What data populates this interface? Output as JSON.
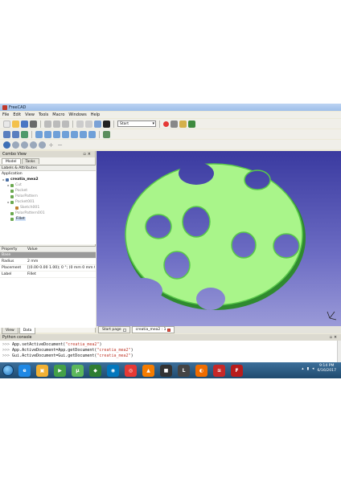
{
  "window": {
    "title": "FreeCAD"
  },
  "menu": [
    "File",
    "Edit",
    "View",
    "Tools",
    "Macro",
    "Windows",
    "Help"
  ],
  "toolbar": {
    "workbench_combo": "Start"
  },
  "combo_view": {
    "title": "Combo View",
    "tabs": [
      "Model",
      "Tasks"
    ],
    "labels_header": "Labels & Attributes",
    "application_label": "Application",
    "tree": [
      {
        "label": "creatia_mea2",
        "level": 0,
        "bold": true,
        "dim": false,
        "color": "#4a6fa5"
      },
      {
        "label": "Cut",
        "level": 1,
        "bold": false,
        "dim": true,
        "color": "#6aa84f"
      },
      {
        "label": "Pocket",
        "level": 1,
        "bold": false,
        "dim": true,
        "color": "#6aa84f"
      },
      {
        "label": "PolarPattern",
        "level": 1,
        "bold": false,
        "dim": true,
        "color": "#6aa84f"
      },
      {
        "label": "Pocket001",
        "level": 1,
        "bold": false,
        "dim": true,
        "color": "#6aa84f"
      },
      {
        "label": "Sketch001",
        "level": 2,
        "bold": false,
        "dim": true,
        "color": "#c08030"
      },
      {
        "label": "PolarPattern001",
        "level": 1,
        "bold": false,
        "dim": true,
        "color": "#6aa84f"
      },
      {
        "label": "Fillet",
        "level": 1,
        "bold": false,
        "dim": false,
        "selected": true,
        "color": "#6aa84f"
      }
    ],
    "property_headers": [
      "Property",
      "Value"
    ],
    "properties": [
      {
        "name": "Base",
        "value": "",
        "group": true
      },
      {
        "name": "Radius",
        "value": "2 mm",
        "group": false
      },
      {
        "name": "Placement",
        "value": "[(0.00 0.00 1.00); 0 °; (0 mm  0 mm  0 mm...",
        "group": false
      },
      {
        "name": "Label",
        "value": "Fillet",
        "group": false
      }
    ],
    "bottom_tabs": [
      "View",
      "Data"
    ]
  },
  "doc_tabs": [
    {
      "label": "Start page",
      "active": false
    },
    {
      "label": "creatia_mea2 : 1",
      "active": true
    }
  ],
  "console": {
    "title": "Python console",
    "lines": [
      {
        "prompt": ">>>",
        "code": " App.setActiveDocument(",
        "str": "\"creatia_mea2\"",
        "end": ")"
      },
      {
        "prompt": ">>>",
        "code": " App.ActiveDocument=App.getDocument(",
        "str": "\"creatia_mea2\"",
        "end": ")"
      },
      {
        "prompt": ">>>",
        "code": " Gui.ActiveDocument=Gui.getDocument(",
        "str": "\"creatia_mea2\"",
        "end": ")"
      }
    ]
  },
  "taskbar": {
    "apps": [
      {
        "name": "ie-icon",
        "color": "#1e88e5",
        "glyph": "e"
      },
      {
        "name": "explorer-icon",
        "color": "#f2b134",
        "glyph": "▣"
      },
      {
        "name": "media-icon",
        "color": "#43a047",
        "glyph": "▶"
      },
      {
        "name": "utorrent-icon",
        "color": "#5cb85c",
        "glyph": "µ"
      },
      {
        "name": "app-icon",
        "color": "#2e7d32",
        "glyph": "◆"
      },
      {
        "name": "app-icon",
        "color": "#0277bd",
        "glyph": "◉"
      },
      {
        "name": "chrome-icon",
        "color": "#e53935",
        "glyph": "◎"
      },
      {
        "name": "vlc-icon",
        "color": "#f57c00",
        "glyph": "▲"
      },
      {
        "name": "app-icon",
        "color": "#333333",
        "glyph": "■"
      },
      {
        "name": "app-icon",
        "color": "#444444",
        "glyph": "L"
      },
      {
        "name": "firefox-icon",
        "color": "#ef6c00",
        "glyph": "◐"
      },
      {
        "name": "app-icon",
        "color": "#c62828",
        "glyph": "≋"
      },
      {
        "name": "freecad-icon",
        "color": "#b71c1c",
        "glyph": "F"
      }
    ],
    "time": "9:14 PM",
    "date": "6/16/2017"
  }
}
